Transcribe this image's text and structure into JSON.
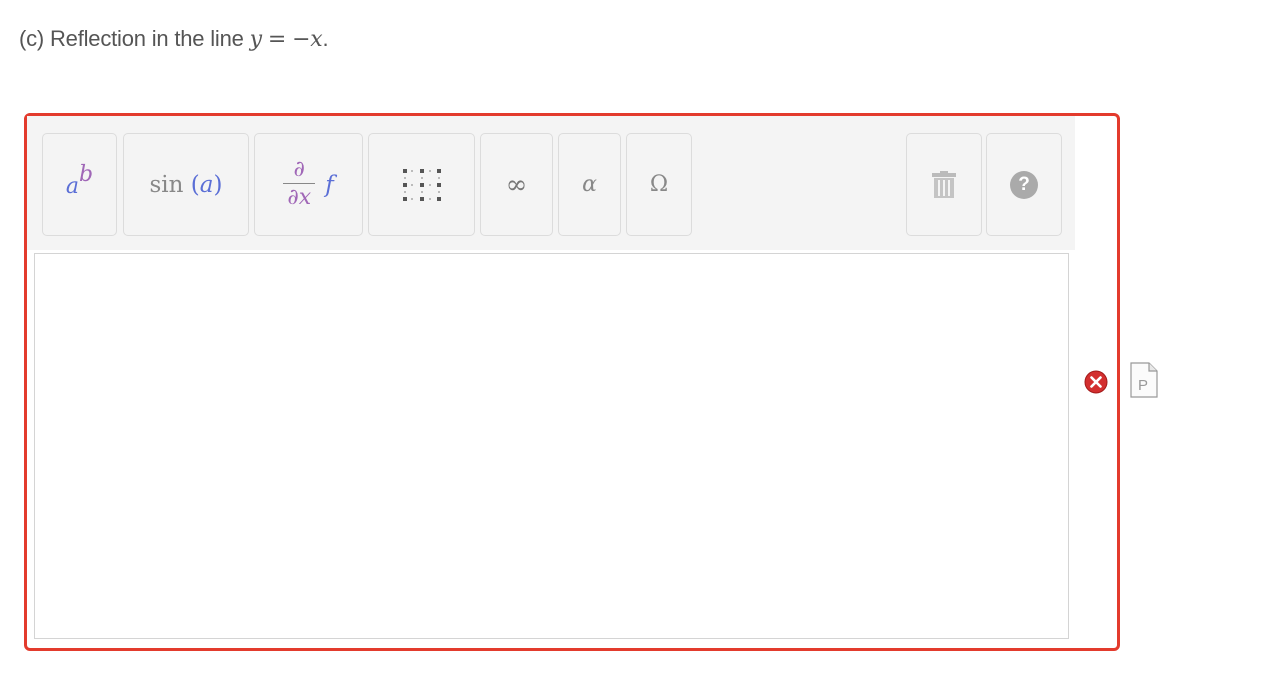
{
  "question": {
    "prefix": "(c) Reflection in the line ",
    "var_y": "y",
    "equals": "=",
    "rhs": "−x",
    "period": "."
  },
  "toolbar": {
    "power": {
      "base": "a",
      "exp": "b"
    },
    "trig": {
      "fn": "sin",
      "open": "(",
      "arg": "a",
      "close": ")"
    },
    "deriv": {
      "num": "∂",
      "den": "∂x",
      "fn": "f"
    },
    "matrix_icon": "matrix-grid-icon",
    "infinity": "∞",
    "alpha": "α",
    "omega": "Ω",
    "trash_icon": "trash-icon",
    "help": "?"
  },
  "status": {
    "error_icon": "error-x-icon",
    "preview_icon": "preview-document-icon",
    "preview_letter": "P"
  },
  "colors": {
    "border_error": "#e33b2d",
    "accent_purple": "#a067b7",
    "accent_blue": "#5b6fd6"
  }
}
